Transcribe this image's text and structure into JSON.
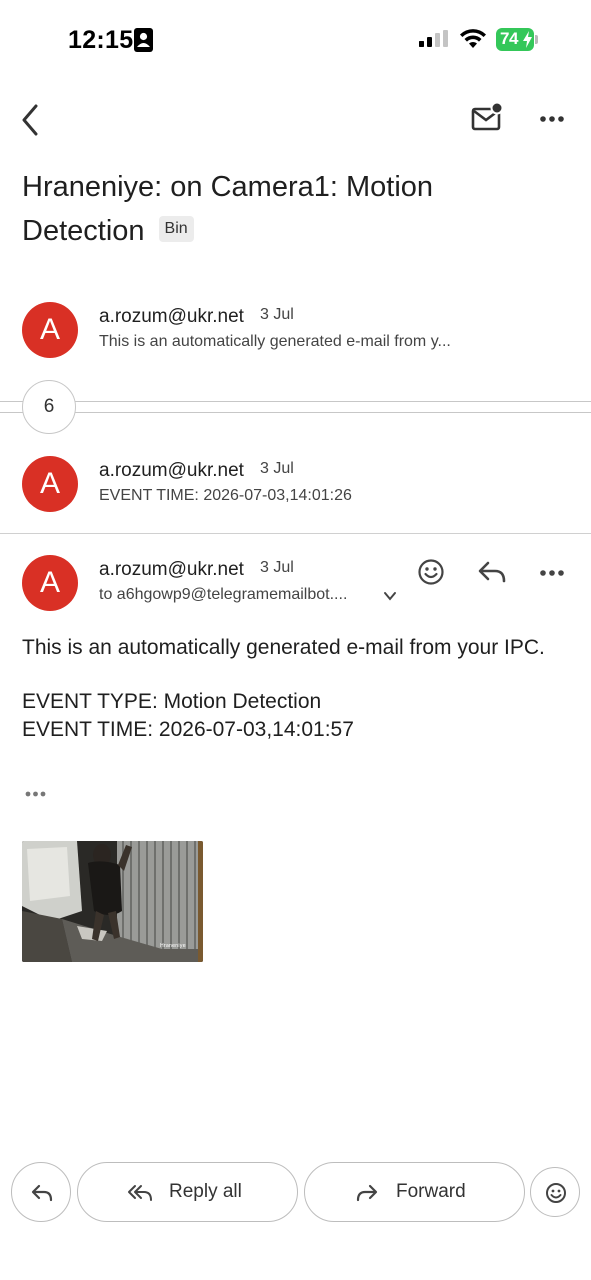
{
  "status_bar": {
    "time": "12:15",
    "battery": "74"
  },
  "subject": {
    "title": "Hraneniye: on Camera1: Motion Detection",
    "label": "Bin"
  },
  "messages": [
    {
      "avatar_letter": "A",
      "sender": "a.rozum@ukr.net",
      "date": "3 Jul",
      "snippet": "This is an automatically generated e-mail from y..."
    },
    {
      "avatar_letter": "A",
      "sender": "a.rozum@ukr.net",
      "date": "3 Jul",
      "snippet": "EVENT TIME: 2026-07-03,14:01:26"
    }
  ],
  "collapsed_count": "6",
  "open_message": {
    "avatar_letter": "A",
    "sender": "a.rozum@ukr.net",
    "date": "3 Jul",
    "to": "to a6hgowp9@telegramemailbot....",
    "body": {
      "line1": "This is an automatically generated e-mail from your IPC.",
      "line2": "EVENT TYPE: Motion Detection",
      "line3": "EVENT TIME: 2026-07-03,14:01:57"
    },
    "attachment": {
      "watermark": "Hraneniye"
    }
  },
  "bottom_bar": {
    "reply_all": "Reply all",
    "forward": "Forward"
  },
  "colors": {
    "avatar": "#d93025",
    "battery": "#34c759"
  }
}
